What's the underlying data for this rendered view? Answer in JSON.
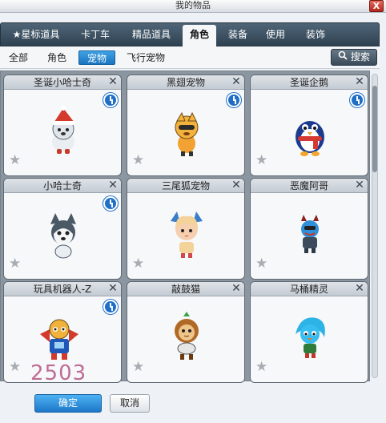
{
  "window": {
    "title": "我的物品",
    "close_label": "X"
  },
  "tabs": [
    {
      "label": "★星标道具",
      "active": false
    },
    {
      "label": "卡丁车",
      "active": false
    },
    {
      "label": "精品道具",
      "active": false
    },
    {
      "label": "角色",
      "active": true
    },
    {
      "label": "装备",
      "active": false
    },
    {
      "label": "使用",
      "active": false
    },
    {
      "label": "装饰",
      "active": false
    }
  ],
  "subtabs": [
    {
      "label": "全部",
      "active": false
    },
    {
      "label": "角色",
      "active": false
    },
    {
      "label": "宠物",
      "active": true
    },
    {
      "label": "飞行宠物",
      "active": false
    }
  ],
  "search": {
    "label": "搜索",
    "icon": "search-icon"
  },
  "items": [
    {
      "name": "圣诞小哈士奇",
      "timed": true,
      "icon": "husky-santa-hat"
    },
    {
      "name": "黑翅宠物",
      "timed": true,
      "icon": "orange-bee-pet"
    },
    {
      "name": "圣诞企鹅",
      "timed": true,
      "icon": "penguin-scarf"
    },
    {
      "name": "小哈士奇",
      "timed": true,
      "icon": "husky-dog"
    },
    {
      "name": "三尾狐宠物",
      "timed": false,
      "icon": "three-tail-fox-girl"
    },
    {
      "name": "恶魔阿哥",
      "timed": false,
      "icon": "blue-devil"
    },
    {
      "name": "玩具机器人-Z",
      "timed": true,
      "icon": "toy-robot"
    },
    {
      "name": "敲鼓猫",
      "timed": false,
      "icon": "drum-cat"
    },
    {
      "name": "马桶精灵",
      "timed": false,
      "icon": "blue-toilet-sprite"
    }
  ],
  "overlay_number": "2503",
  "footer": {
    "ok_label": "确定",
    "cancel_label": "取消"
  },
  "colors": {
    "accent": "#1f78c8",
    "tabbar": "#3a4e60",
    "badge": "#b04a7d"
  }
}
